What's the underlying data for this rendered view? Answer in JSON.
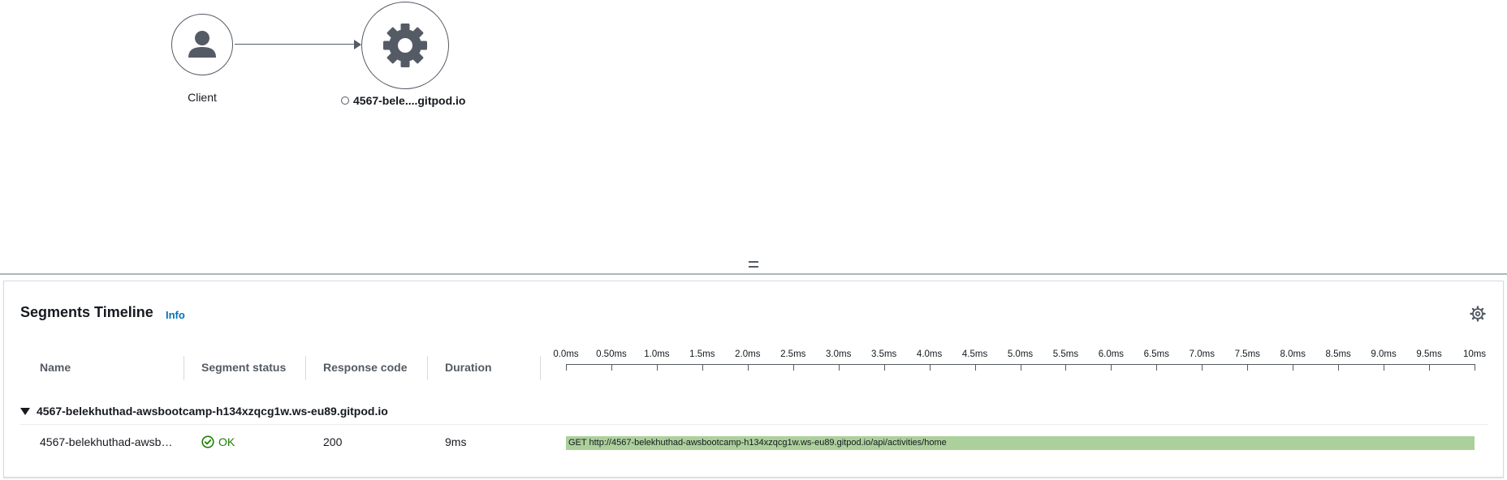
{
  "map": {
    "client_label": "Client",
    "service_label": "4567-bele....gitpod.io",
    "client_icon": "user-icon",
    "service_icon": "gear-icon"
  },
  "panel": {
    "title": "Segments Timeline",
    "info_label": "Info",
    "settings_icon": "gear-icon"
  },
  "table": {
    "headers": [
      "Name",
      "Segment status",
      "Response code",
      "Duration"
    ],
    "timeline_ticks": [
      "0.0ms",
      "0.50ms",
      "1.0ms",
      "1.5ms",
      "2.0ms",
      "2.5ms",
      "3.0ms",
      "3.5ms",
      "4.0ms",
      "4.5ms",
      "5.0ms",
      "5.5ms",
      "6.0ms",
      "6.5ms",
      "7.0ms",
      "7.5ms",
      "8.0ms",
      "8.5ms",
      "9.0ms",
      "9.5ms",
      "10ms"
    ],
    "group_name": "4567-belekhuthad-awsbootcamp-h134xzqcg1w.ws-eu89.gitpod.io",
    "rows": [
      {
        "name": "4567-belekhuthad-awsb…",
        "status": "OK",
        "response_code": "200",
        "duration": "9ms",
        "bar_label": "GET http://4567-belekhuthad-awsbootcamp-h134xzqcg1w.ws-eu89.gitpod.io/api/activities/home",
        "bar_start": 0.0,
        "bar_end": 10.0
      }
    ]
  },
  "colors": {
    "accent": "#0073bb",
    "ok": "#1d8102",
    "bar": "#acd09c"
  }
}
